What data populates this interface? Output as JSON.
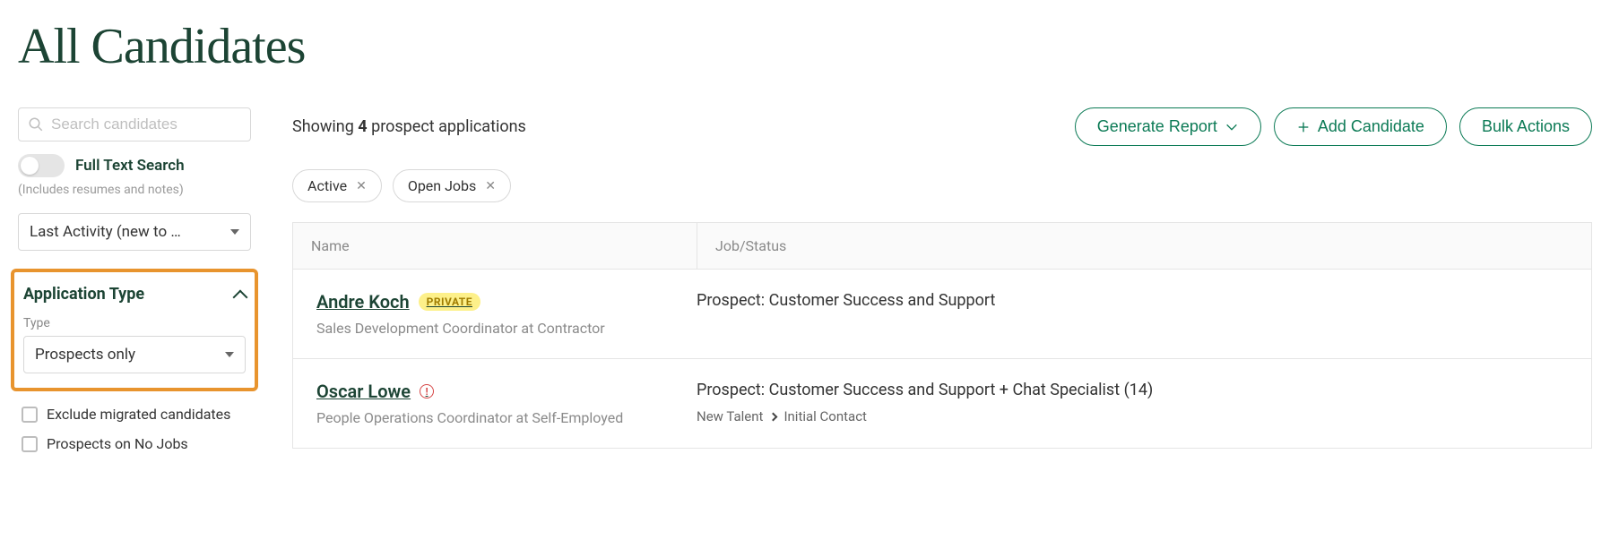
{
  "page_title": "All Candidates",
  "sidebar": {
    "search_placeholder": "Search candidates",
    "full_text_label": "Full Text Search",
    "full_text_hint": "(Includes resumes and notes)",
    "sort_selected": "Last Activity (new to …",
    "application_type": {
      "header": "Application Type",
      "type_label": "Type",
      "type_selected": "Prospects only"
    },
    "checks": [
      {
        "label": "Exclude migrated candidates"
      },
      {
        "label": "Prospects on No Jobs"
      }
    ]
  },
  "main": {
    "showing_prefix": "Showing ",
    "showing_count": "4",
    "showing_suffix": " prospect applications",
    "buttons": {
      "generate_report": "Generate Report",
      "add_candidate": "Add Candidate",
      "bulk_actions": "Bulk Actions"
    },
    "chips": [
      {
        "label": "Active"
      },
      {
        "label": "Open Jobs"
      }
    ],
    "columns": {
      "name": "Name",
      "job": "Job/Status"
    },
    "rows": [
      {
        "name": "Andre Koch",
        "badge": "PRIVATE",
        "subtitle": "Sales Development Coordinator at Contractor",
        "job": "Prospect: Customer Success and Support",
        "status_from": "",
        "status_to": ""
      },
      {
        "name": "Oscar Lowe",
        "alert": true,
        "subtitle": "People Operations Coordinator at Self-Employed",
        "job": "Prospect: Customer Success and Support + Chat Specialist (14)",
        "status_from": "New Talent",
        "status_to": "Initial Contact"
      }
    ]
  }
}
